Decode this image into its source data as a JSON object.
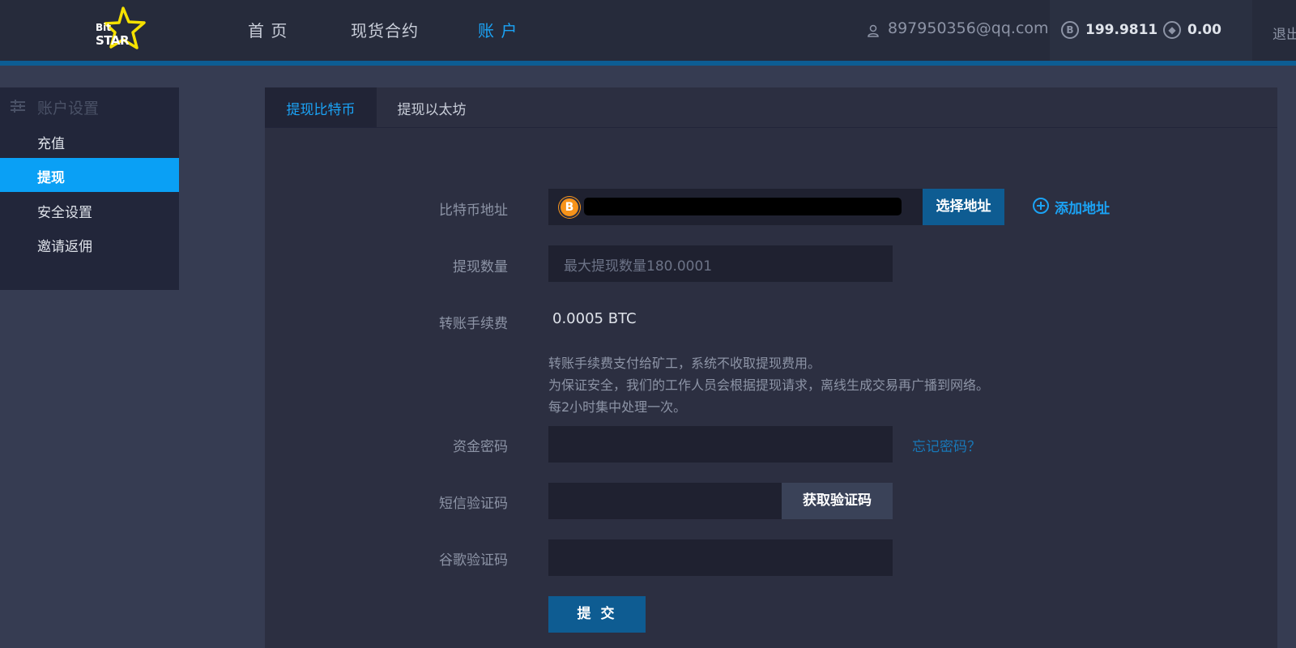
{
  "header": {
    "logo": {
      "top": "Bit",
      "bottom": "STAR"
    },
    "nav": [
      {
        "label": "首 页"
      },
      {
        "label": "现货合约"
      },
      {
        "label": "账 户"
      }
    ],
    "user_email": "897950356@qq.com",
    "balances": [
      {
        "icon": "bitcoin-icon",
        "value": "199.9811"
      },
      {
        "icon": "ethereum-icon",
        "value": "0.00"
      }
    ],
    "logout_label": "退出"
  },
  "sidebar": {
    "heading": "账户设置",
    "items": [
      {
        "label": "充值"
      },
      {
        "label": "提现"
      },
      {
        "label": "安全设置"
      },
      {
        "label": "邀请返佣"
      }
    ]
  },
  "tabs": [
    {
      "label": "提现比特币"
    },
    {
      "label": "提现以太坊"
    }
  ],
  "form": {
    "address_label": "比特币地址",
    "select_address_label": "选择地址",
    "add_address_label": "添加地址",
    "amount_label": "提现数量",
    "amount_placeholder": "最大提现数量180.0001",
    "fee_label": "转账手续费",
    "fee_value": "0.0005 BTC",
    "notes": [
      "转账手续费支付给矿工，系统不收取提现费用。",
      "为保证安全，我们的工作人员会根据提现请求，离线生成交易再广播到网络。",
      "每2小时集中处理一次。"
    ],
    "fund_password_label": "资金密码",
    "forgot_password_label": "忘记密码？",
    "sms_code_label": "短信验证码",
    "get_code_label": "获取验证码",
    "google_code_label": "谷歌验证码",
    "submit_label": "提 交"
  },
  "colors": {
    "accent": "#1ba3f5",
    "button": "#0e5c92",
    "panel": "#2c2f41",
    "page_bg": "#363c52"
  }
}
